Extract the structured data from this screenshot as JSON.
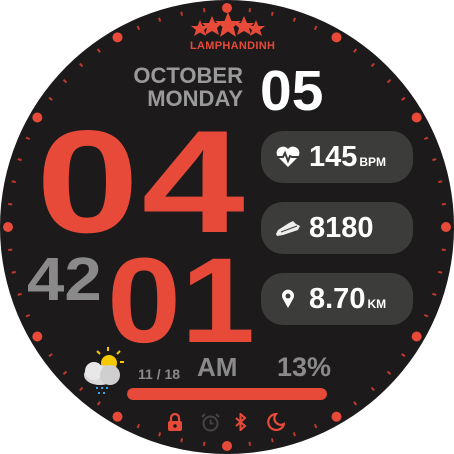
{
  "brand": {
    "logo_text": "LAMPHANDINH"
  },
  "date": {
    "month": "OCTOBER",
    "weekday": "MONDAY",
    "day": "05"
  },
  "time": {
    "hour": "04",
    "minute": "01",
    "second": "42",
    "ampm": "AM"
  },
  "stats": [
    {
      "icon": "heart-rate-icon",
      "value": "145",
      "unit": "BPM"
    },
    {
      "icon": "shoe-icon",
      "value": "8180",
      "unit": ""
    },
    {
      "icon": "location-pin-icon",
      "value": "8.70",
      "unit": "KM"
    }
  ],
  "weather": {
    "icon": "partly-cloudy-rain-icon",
    "temp_range": "11 / 18"
  },
  "battery": {
    "percent_label": "13%",
    "bar_fill": 1.0
  },
  "status_icons": [
    "lock-icon",
    "alarm-icon",
    "bluetooth-icon",
    "moon-icon"
  ],
  "colors": {
    "accent": "#e84a3a",
    "background": "#1c1a1a",
    "pill": "#3c3d3b",
    "gray": "#8a8a8a"
  }
}
